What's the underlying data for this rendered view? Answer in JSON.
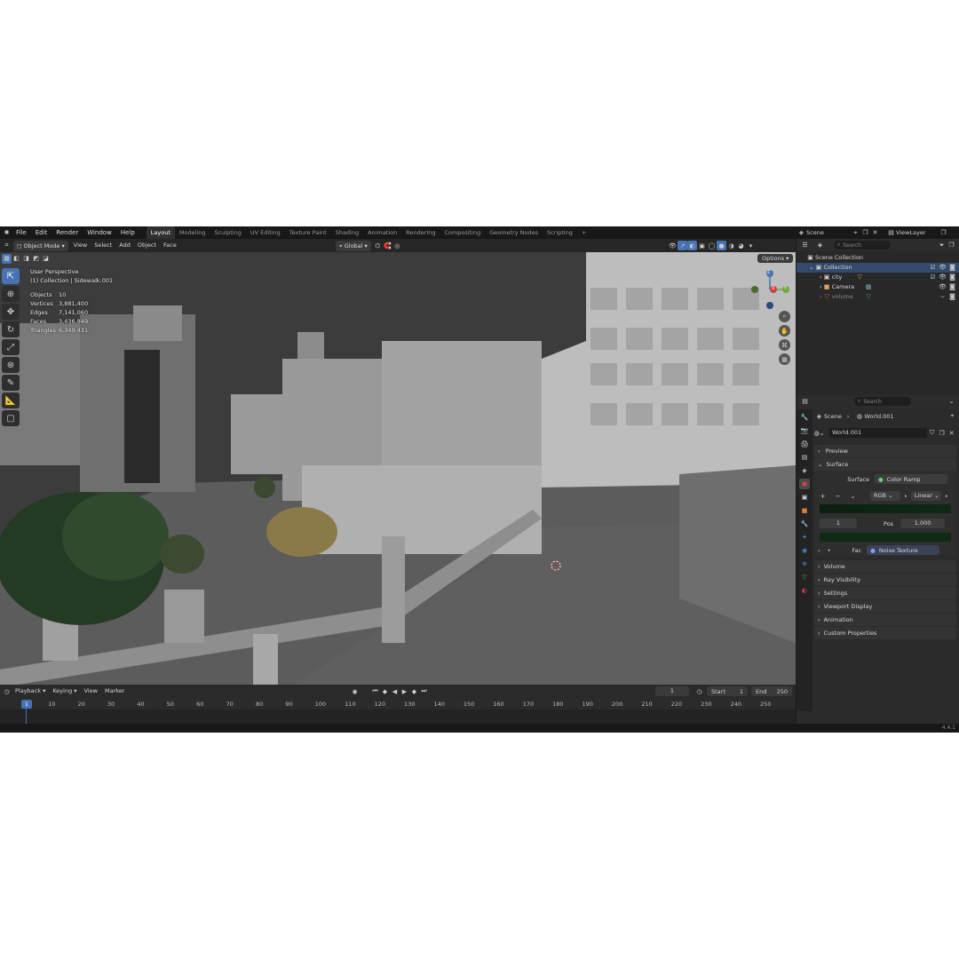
{
  "menu": [
    "File",
    "Edit",
    "Render",
    "Window",
    "Help"
  ],
  "workspaces": [
    {
      "label": "Layout",
      "active": true
    },
    {
      "label": "Modeling"
    },
    {
      "label": "Sculpting"
    },
    {
      "label": "UV Editing"
    },
    {
      "label": "Texture Paint"
    },
    {
      "label": "Shading"
    },
    {
      "label": "Animation"
    },
    {
      "label": "Rendering"
    },
    {
      "label": "Compositing"
    },
    {
      "label": "Geometry Nodes"
    },
    {
      "label": "Scripting"
    }
  ],
  "workspace_add": "+",
  "scene_field": "Scene",
  "viewlayer_field": "ViewLayer",
  "viewport_header": {
    "mode": "Object Mode",
    "menus": [
      "View",
      "Select",
      "Add",
      "Object",
      "Face"
    ],
    "transform": "Global",
    "options": "Options"
  },
  "overlay": {
    "title": "User Perspective",
    "subtitle": "(1) Collection | Sidewalk.001",
    "stats": [
      {
        "label": "Objects",
        "value": "10"
      },
      {
        "label": "Vertices",
        "value": "3,881,400"
      },
      {
        "label": "Edges",
        "value": "7,141,060"
      },
      {
        "label": "Faces",
        "value": "3,436,849"
      },
      {
        "label": "Triangles",
        "value": "6,349,431"
      }
    ]
  },
  "gizmo": {
    "z": "Z",
    "y": "Y",
    "x": "X"
  },
  "timeline": {
    "menus": [
      "Playback",
      "Keying",
      "View",
      "Marker"
    ],
    "current_frame": "1",
    "start_label": "Start",
    "start": "1",
    "end_label": "End",
    "end": "250",
    "ticks": [
      "1",
      "10",
      "20",
      "30",
      "40",
      "50",
      "60",
      "70",
      "80",
      "90",
      "100",
      "110",
      "120",
      "130",
      "140",
      "150",
      "160",
      "170",
      "180",
      "190",
      "200",
      "210",
      "220",
      "230",
      "240",
      "250"
    ]
  },
  "outliner": {
    "search_placeholder": "Search",
    "root": "Scene Collection",
    "collection": "Collection",
    "items": [
      "city",
      "Camera",
      "volume"
    ]
  },
  "properties": {
    "search_placeholder": "Search",
    "breadcrumb_scene": "Scene",
    "breadcrumb_world": "World.001",
    "world_name": "World.001",
    "sections": {
      "preview": "Preview",
      "surface": "Surface",
      "volume": "Volume",
      "ray_visibility": "Ray Visibility",
      "settings": "Settings",
      "viewport_display": "Viewport Display",
      "animation": "Animation",
      "custom_properties": "Custom Properties"
    },
    "surface_label": "Surface",
    "surface_value": "Color Ramp",
    "ramp_mode": "RGB",
    "ramp_interp": "Linear",
    "ramp_index": "1",
    "pos_label": "Pos",
    "pos_value": "1.000",
    "fac_label": "Fac",
    "fac_value": "Noise Texture",
    "ramp_color": "#0e2a14"
  },
  "version": "4.4.1"
}
